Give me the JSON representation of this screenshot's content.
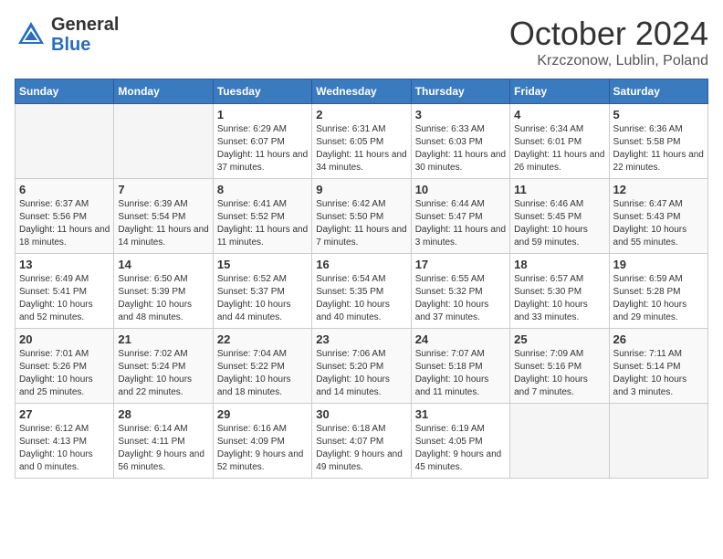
{
  "header": {
    "logo_general": "General",
    "logo_blue": "Blue",
    "month": "October 2024",
    "location": "Krzczonow, Lublin, Poland"
  },
  "days_of_week": [
    "Sunday",
    "Monday",
    "Tuesday",
    "Wednesday",
    "Thursday",
    "Friday",
    "Saturday"
  ],
  "weeks": [
    [
      {
        "day": "",
        "empty": true
      },
      {
        "day": "",
        "empty": true
      },
      {
        "day": "1",
        "sunrise": "Sunrise: 6:29 AM",
        "sunset": "Sunset: 6:07 PM",
        "daylight": "Daylight: 11 hours and 37 minutes."
      },
      {
        "day": "2",
        "sunrise": "Sunrise: 6:31 AM",
        "sunset": "Sunset: 6:05 PM",
        "daylight": "Daylight: 11 hours and 34 minutes."
      },
      {
        "day": "3",
        "sunrise": "Sunrise: 6:33 AM",
        "sunset": "Sunset: 6:03 PM",
        "daylight": "Daylight: 11 hours and 30 minutes."
      },
      {
        "day": "4",
        "sunrise": "Sunrise: 6:34 AM",
        "sunset": "Sunset: 6:01 PM",
        "daylight": "Daylight: 11 hours and 26 minutes."
      },
      {
        "day": "5",
        "sunrise": "Sunrise: 6:36 AM",
        "sunset": "Sunset: 5:58 PM",
        "daylight": "Daylight: 11 hours and 22 minutes."
      }
    ],
    [
      {
        "day": "6",
        "sunrise": "Sunrise: 6:37 AM",
        "sunset": "Sunset: 5:56 PM",
        "daylight": "Daylight: 11 hours and 18 minutes."
      },
      {
        "day": "7",
        "sunrise": "Sunrise: 6:39 AM",
        "sunset": "Sunset: 5:54 PM",
        "daylight": "Daylight: 11 hours and 14 minutes."
      },
      {
        "day": "8",
        "sunrise": "Sunrise: 6:41 AM",
        "sunset": "Sunset: 5:52 PM",
        "daylight": "Daylight: 11 hours and 11 minutes."
      },
      {
        "day": "9",
        "sunrise": "Sunrise: 6:42 AM",
        "sunset": "Sunset: 5:50 PM",
        "daylight": "Daylight: 11 hours and 7 minutes."
      },
      {
        "day": "10",
        "sunrise": "Sunrise: 6:44 AM",
        "sunset": "Sunset: 5:47 PM",
        "daylight": "Daylight: 11 hours and 3 minutes."
      },
      {
        "day": "11",
        "sunrise": "Sunrise: 6:46 AM",
        "sunset": "Sunset: 5:45 PM",
        "daylight": "Daylight: 10 hours and 59 minutes."
      },
      {
        "day": "12",
        "sunrise": "Sunrise: 6:47 AM",
        "sunset": "Sunset: 5:43 PM",
        "daylight": "Daylight: 10 hours and 55 minutes."
      }
    ],
    [
      {
        "day": "13",
        "sunrise": "Sunrise: 6:49 AM",
        "sunset": "Sunset: 5:41 PM",
        "daylight": "Daylight: 10 hours and 52 minutes."
      },
      {
        "day": "14",
        "sunrise": "Sunrise: 6:50 AM",
        "sunset": "Sunset: 5:39 PM",
        "daylight": "Daylight: 10 hours and 48 minutes."
      },
      {
        "day": "15",
        "sunrise": "Sunrise: 6:52 AM",
        "sunset": "Sunset: 5:37 PM",
        "daylight": "Daylight: 10 hours and 44 minutes."
      },
      {
        "day": "16",
        "sunrise": "Sunrise: 6:54 AM",
        "sunset": "Sunset: 5:35 PM",
        "daylight": "Daylight: 10 hours and 40 minutes."
      },
      {
        "day": "17",
        "sunrise": "Sunrise: 6:55 AM",
        "sunset": "Sunset: 5:32 PM",
        "daylight": "Daylight: 10 hours and 37 minutes."
      },
      {
        "day": "18",
        "sunrise": "Sunrise: 6:57 AM",
        "sunset": "Sunset: 5:30 PM",
        "daylight": "Daylight: 10 hours and 33 minutes."
      },
      {
        "day": "19",
        "sunrise": "Sunrise: 6:59 AM",
        "sunset": "Sunset: 5:28 PM",
        "daylight": "Daylight: 10 hours and 29 minutes."
      }
    ],
    [
      {
        "day": "20",
        "sunrise": "Sunrise: 7:01 AM",
        "sunset": "Sunset: 5:26 PM",
        "daylight": "Daylight: 10 hours and 25 minutes."
      },
      {
        "day": "21",
        "sunrise": "Sunrise: 7:02 AM",
        "sunset": "Sunset: 5:24 PM",
        "daylight": "Daylight: 10 hours and 22 minutes."
      },
      {
        "day": "22",
        "sunrise": "Sunrise: 7:04 AM",
        "sunset": "Sunset: 5:22 PM",
        "daylight": "Daylight: 10 hours and 18 minutes."
      },
      {
        "day": "23",
        "sunrise": "Sunrise: 7:06 AM",
        "sunset": "Sunset: 5:20 PM",
        "daylight": "Daylight: 10 hours and 14 minutes."
      },
      {
        "day": "24",
        "sunrise": "Sunrise: 7:07 AM",
        "sunset": "Sunset: 5:18 PM",
        "daylight": "Daylight: 10 hours and 11 minutes."
      },
      {
        "day": "25",
        "sunrise": "Sunrise: 7:09 AM",
        "sunset": "Sunset: 5:16 PM",
        "daylight": "Daylight: 10 hours and 7 minutes."
      },
      {
        "day": "26",
        "sunrise": "Sunrise: 7:11 AM",
        "sunset": "Sunset: 5:14 PM",
        "daylight": "Daylight: 10 hours and 3 minutes."
      }
    ],
    [
      {
        "day": "27",
        "sunrise": "Sunrise: 6:12 AM",
        "sunset": "Sunset: 4:13 PM",
        "daylight": "Daylight: 10 hours and 0 minutes."
      },
      {
        "day": "28",
        "sunrise": "Sunrise: 6:14 AM",
        "sunset": "Sunset: 4:11 PM",
        "daylight": "Daylight: 9 hours and 56 minutes."
      },
      {
        "day": "29",
        "sunrise": "Sunrise: 6:16 AM",
        "sunset": "Sunset: 4:09 PM",
        "daylight": "Daylight: 9 hours and 52 minutes."
      },
      {
        "day": "30",
        "sunrise": "Sunrise: 6:18 AM",
        "sunset": "Sunset: 4:07 PM",
        "daylight": "Daylight: 9 hours and 49 minutes."
      },
      {
        "day": "31",
        "sunrise": "Sunrise: 6:19 AM",
        "sunset": "Sunset: 4:05 PM",
        "daylight": "Daylight: 9 hours and 45 minutes."
      },
      {
        "day": "",
        "empty": true
      },
      {
        "day": "",
        "empty": true
      }
    ]
  ]
}
